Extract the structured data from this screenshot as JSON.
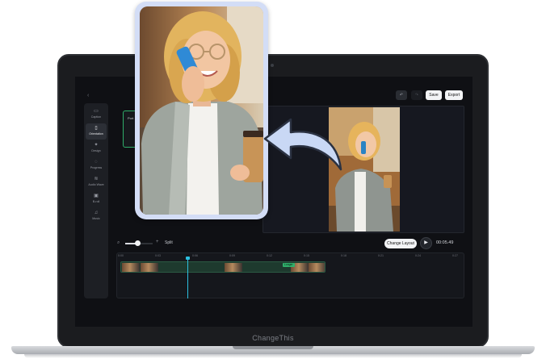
{
  "brand": "ChangeThis",
  "sidebar": {
    "items": [
      {
        "label": "Caption",
        "icon": "caption-icon"
      },
      {
        "label": "Orientation",
        "icon": "orientation-icon",
        "active": true
      },
      {
        "label": "Design",
        "icon": "design-icon"
      },
      {
        "label": "Progress",
        "icon": "progress-icon"
      },
      {
        "label": "Audio Wave",
        "icon": "audio-wave-icon"
      },
      {
        "label": "B-roll",
        "icon": "b-roll-icon"
      },
      {
        "label": "Music",
        "icon": "music-icon"
      }
    ]
  },
  "panel": {
    "tile_label": "Port"
  },
  "toolbar": {
    "save_label": "Save",
    "export_label": "Export"
  },
  "controls": {
    "split_label": "Split",
    "change_layout_label": "Change Layout",
    "time": "00:05.49",
    "zoom_level": 0.45
  },
  "timeline": {
    "ticks": [
      "0:00",
      "0:03",
      "0:06",
      "0:09",
      "0:12",
      "0:15",
      "0:18",
      "0:21",
      "0:24",
      "0:27"
    ],
    "clip_tag": "Longer"
  },
  "colors": {
    "accent_green": "#2fae6a",
    "playhead": "#2cc0e0",
    "card_bg": "#d3ddf6",
    "arrow": "#c9d8f5"
  }
}
